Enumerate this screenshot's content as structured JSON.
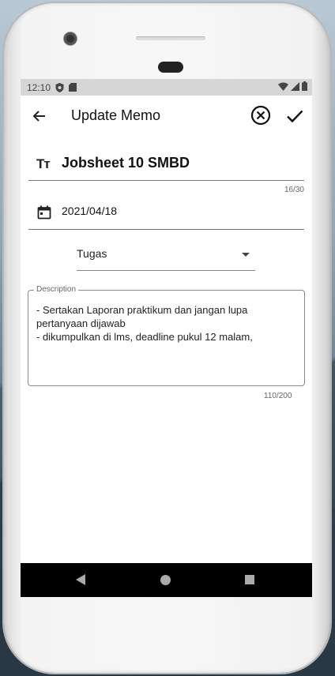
{
  "status_bar": {
    "time": "12:10"
  },
  "app_bar": {
    "title": "Update Memo",
    "back_icon": "arrow-back-icon",
    "cancel_icon": "circle-x-icon",
    "confirm_icon": "check-icon"
  },
  "form": {
    "title": {
      "icon": "text-fields-icon",
      "icon_glyph": "Tт",
      "value": "Jobsheet 10 SMBD",
      "counter": "16/30"
    },
    "date": {
      "icon": "calendar-icon",
      "value": "2021/04/18"
    },
    "category": {
      "selected": "Tugas"
    },
    "description": {
      "label": "Description",
      "value": "- Sertakan Laporan praktikum dan jangan lupa pertanyaan dijawab\n- dikumpulkan di lms, deadline pukul 12 malam,",
      "counter": "110/200"
    }
  },
  "colors": {
    "accent": "#111111",
    "status_bar_bg": "#d6d6d6",
    "nav_bar_bg": "#000000"
  }
}
